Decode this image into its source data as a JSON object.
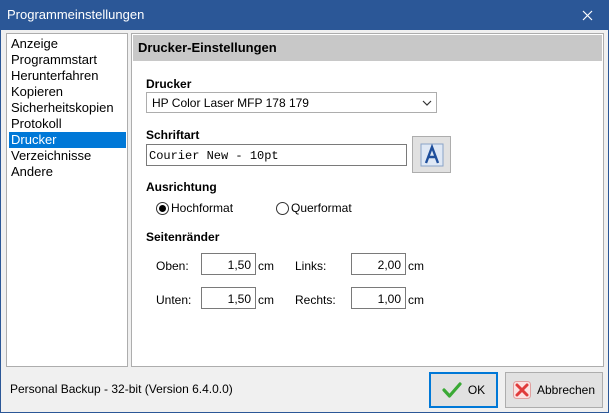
{
  "window": {
    "title": "Programmeinstellungen"
  },
  "nav": {
    "items": [
      {
        "label": "Anzeige",
        "selected": false
      },
      {
        "label": "Programmstart",
        "selected": false
      },
      {
        "label": "Herunterfahren",
        "selected": false
      },
      {
        "label": "Kopieren",
        "selected": false
      },
      {
        "label": "Sicherheitskopien",
        "selected": false
      },
      {
        "label": "Protokoll",
        "selected": false
      },
      {
        "label": "Drucker",
        "selected": true
      },
      {
        "label": "Verzeichnisse",
        "selected": false
      },
      {
        "label": "Andere",
        "selected": false
      }
    ]
  },
  "panel": {
    "header": "Drucker-Einstellungen",
    "printer": {
      "label": "Drucker",
      "value": "HP Color Laser MFP 178 179"
    },
    "font": {
      "label": "Schriftart",
      "value": "Courier New - 10pt"
    },
    "orientation": {
      "label": "Ausrichtung",
      "portrait": "Hochformat",
      "landscape": "Querformat",
      "selected": "Hochformat"
    },
    "margins": {
      "label": "Seitenränder",
      "top_label": "Oben:",
      "top_value": "1,50",
      "bottom_label": "Unten:",
      "bottom_value": "1,50",
      "left_label": "Links:",
      "left_value": "2,00",
      "right_label": "Rechts:",
      "right_value": "1,00",
      "unit": "cm"
    }
  },
  "status_text": "Personal Backup - 32-bit (Version 6.4.0.0)",
  "buttons": {
    "ok": "OK",
    "cancel": "Abbrechen"
  },
  "colors": {
    "titlebar": "#2b5797",
    "selection": "#0078d7",
    "ok_check": "#3aa935",
    "cancel_x": "#e03b3b"
  }
}
